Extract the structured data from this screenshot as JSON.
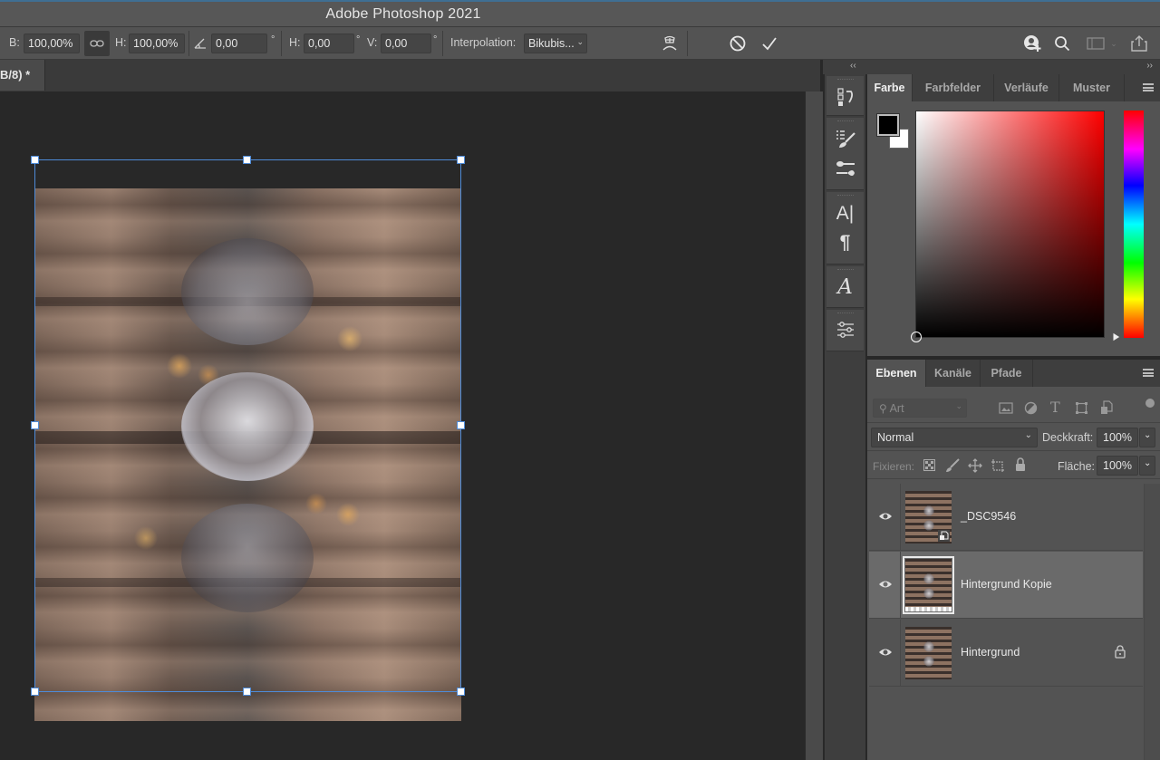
{
  "app": {
    "title": "Adobe Photoshop 2021"
  },
  "options_bar": {
    "width_label": "B:",
    "width_value": "100,00%",
    "height_label": "H:",
    "height_value": "100,00%",
    "angle_value": "0,00",
    "angle_unit": "°",
    "hskew_label": "H:",
    "hskew_value": "0,00",
    "hskew_unit": "°",
    "vskew_label": "V:",
    "vskew_value": "0,00",
    "vskew_unit": "°",
    "interpolation_label": "Interpolation:",
    "interpolation_value": "Bikubis...",
    "icons": [
      "link-icon",
      "angle-icon",
      "warp-icon",
      "cancel-icon",
      "commit-icon",
      "share-user-icon",
      "search-icon",
      "workspace-icon",
      "export-icon"
    ]
  },
  "document_tab": {
    "label": "B/8) *"
  },
  "panel_collapse": {
    "left": "‹‹",
    "right": "››"
  },
  "toolstrip": {
    "icons": [
      "history-icon",
      "brush-presets-icon",
      "brush-settings-icon",
      "character-icon",
      "paragraph-icon",
      "glyphs-icon",
      "adjustments-icon"
    ]
  },
  "color_panel": {
    "tabs": [
      "Farbe",
      "Farbfelder",
      "Verläufe",
      "Muster"
    ],
    "active_tab": 0,
    "foreground_color": "#000000",
    "background_color": "#ffffff",
    "hue_color": "#ff0000"
  },
  "layers_panel": {
    "tabs": [
      "Ebenen",
      "Kanäle",
      "Pfade"
    ],
    "active_tab": 0,
    "filter_placeholder": "Art",
    "blend_mode": "Normal",
    "opacity_label": "Deckkraft:",
    "opacity_value": "100%",
    "lock_label": "Fixieren:",
    "fill_label": "Fläche:",
    "fill_value": "100%",
    "layers": [
      {
        "name": "_DSC9546",
        "visible": true,
        "smart_object": true,
        "selected": false,
        "locked": false
      },
      {
        "name": "Hintergrund Kopie",
        "visible": true,
        "smart_object": false,
        "selected": true,
        "locked": false
      },
      {
        "name": "Hintergrund",
        "visible": true,
        "smart_object": false,
        "selected": false,
        "locked": true
      }
    ]
  }
}
